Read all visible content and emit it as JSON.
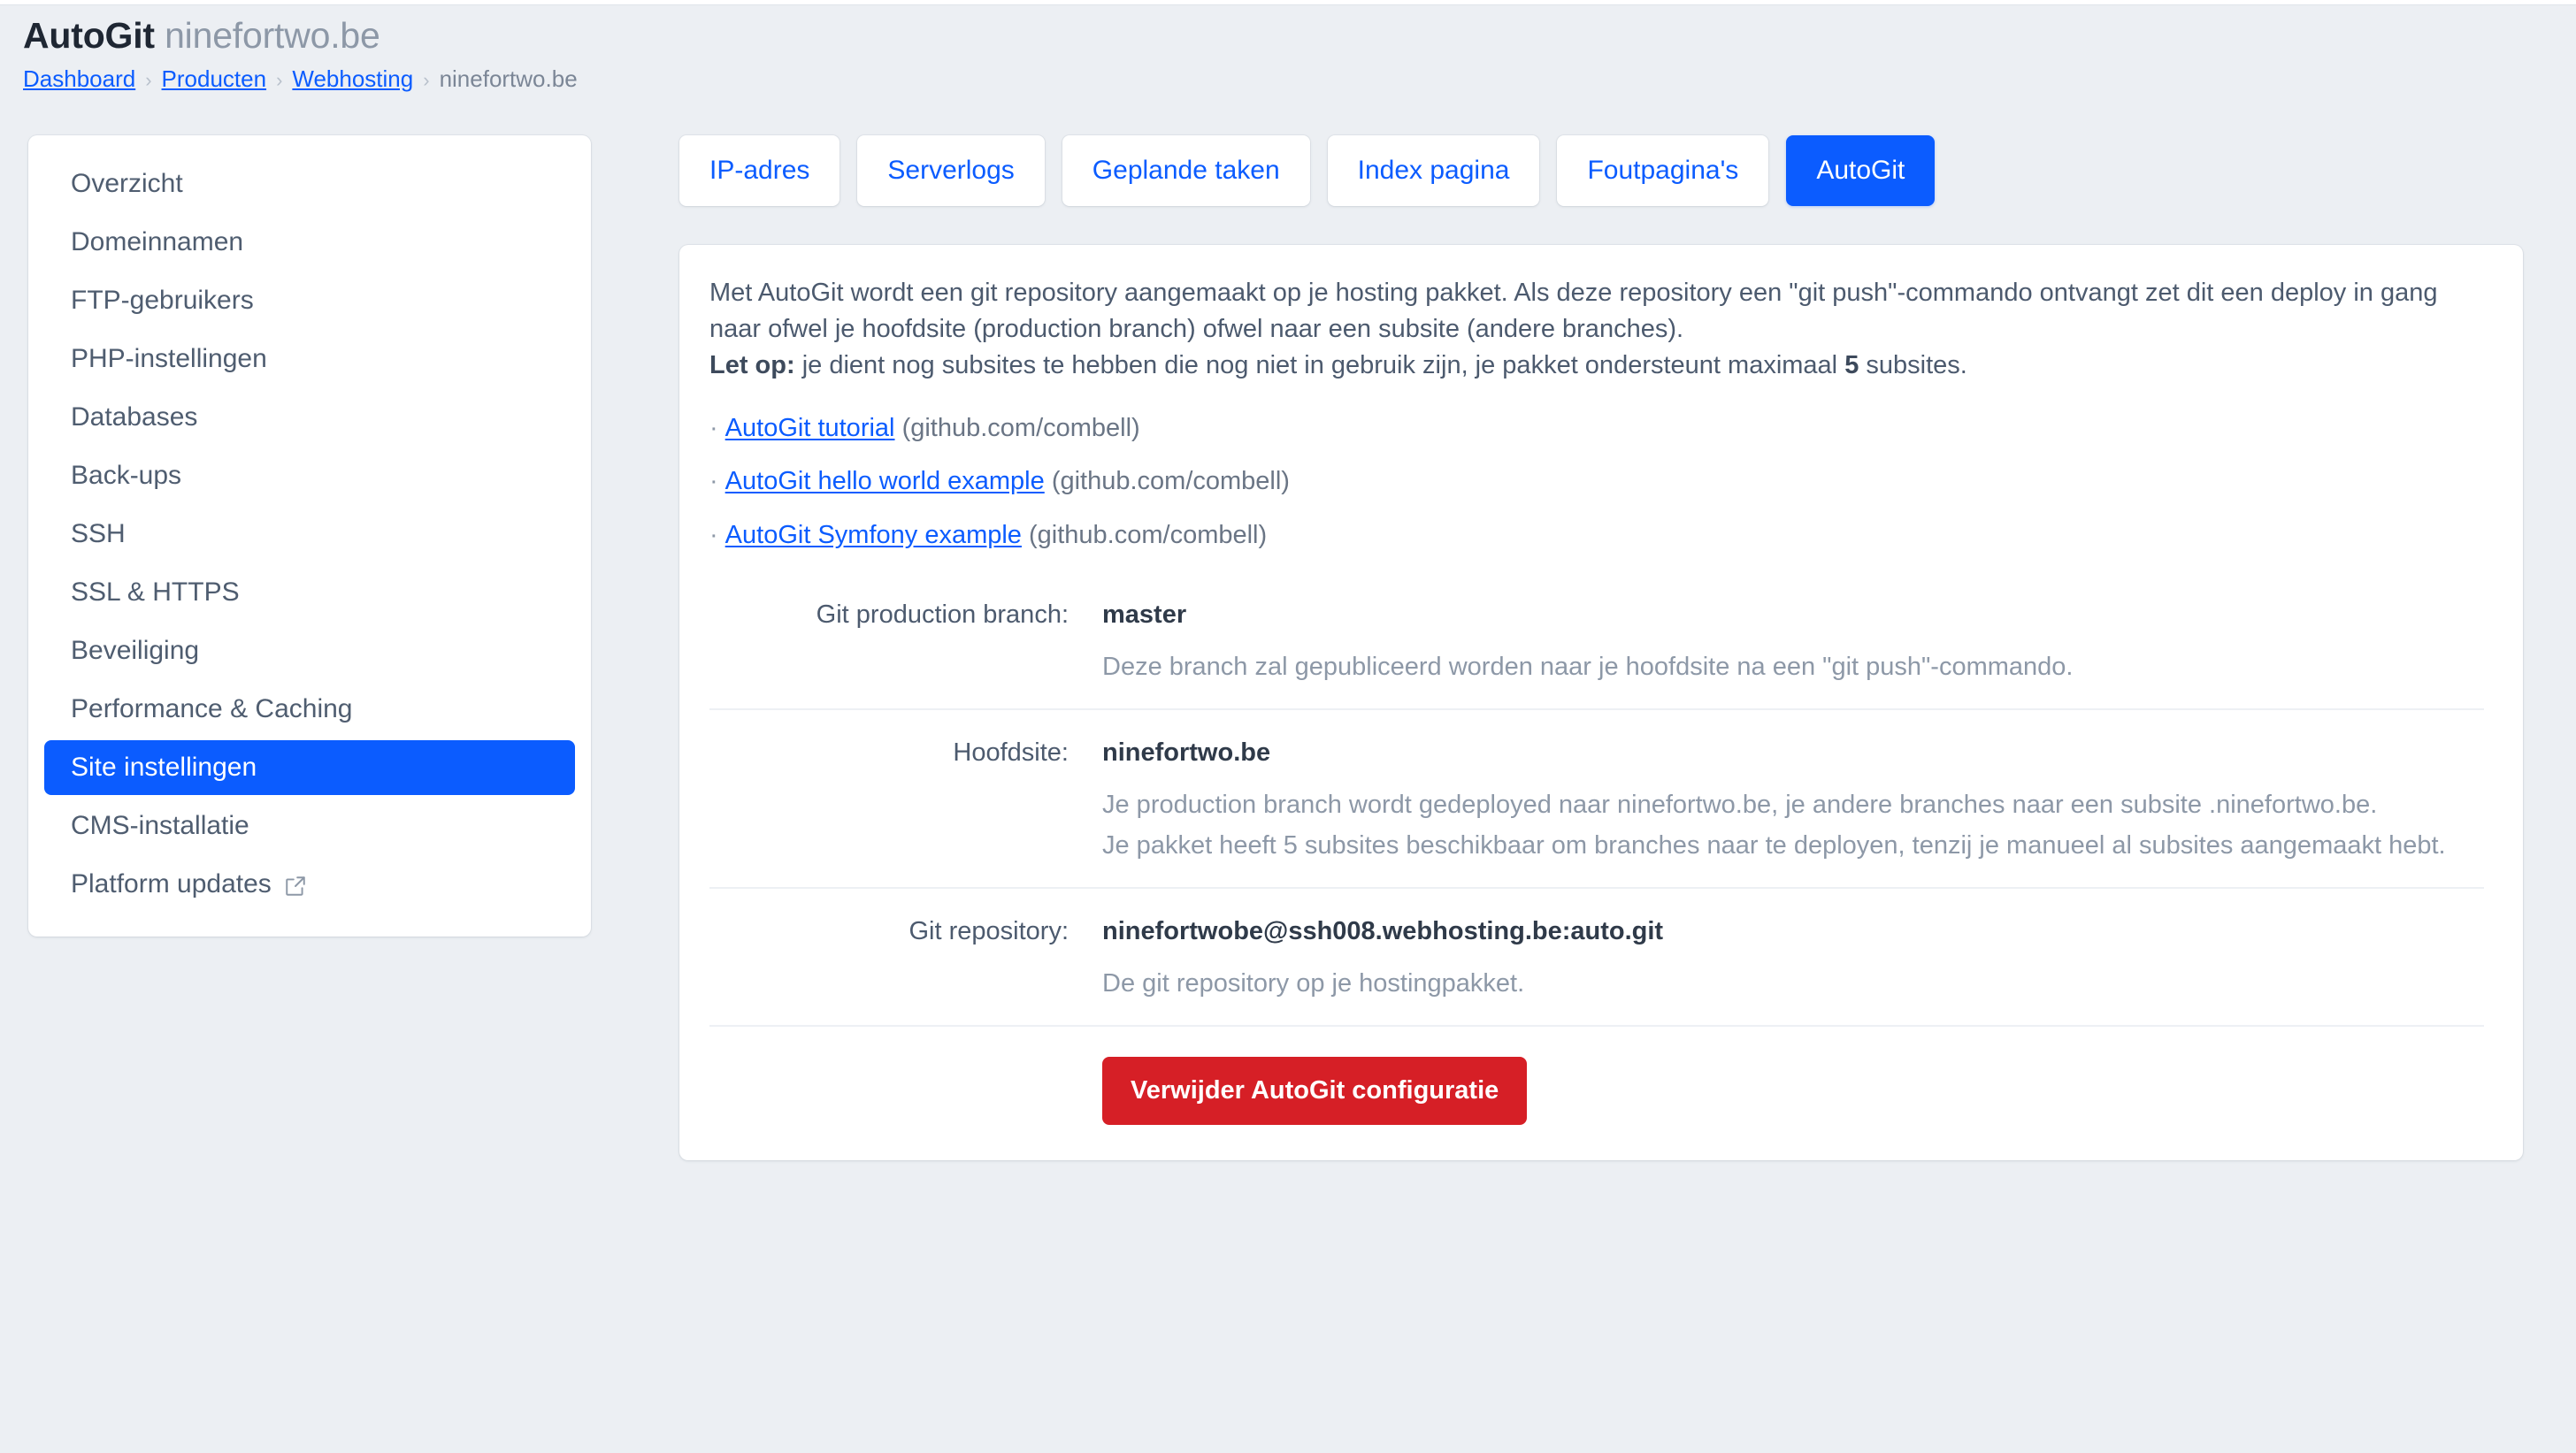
{
  "header": {
    "title_strong": "AutoGit",
    "title_rest": " ninefortwo.be",
    "breadcrumb": [
      {
        "label": "Dashboard",
        "link": true
      },
      {
        "label": "Producten",
        "link": true
      },
      {
        "label": "Webhosting",
        "link": true
      },
      {
        "label": "ninefortwo.be",
        "link": false
      }
    ],
    "separator": "›"
  },
  "sidebar": {
    "items": [
      {
        "label": "Overzicht",
        "active": false,
        "external": false
      },
      {
        "label": "Domeinnamen",
        "active": false,
        "external": false
      },
      {
        "label": "FTP-gebruikers",
        "active": false,
        "external": false
      },
      {
        "label": "PHP-instellingen",
        "active": false,
        "external": false
      },
      {
        "label": "Databases",
        "active": false,
        "external": false
      },
      {
        "label": "Back-ups",
        "active": false,
        "external": false
      },
      {
        "label": "SSH",
        "active": false,
        "external": false
      },
      {
        "label": "SSL & HTTPS",
        "active": false,
        "external": false
      },
      {
        "label": "Beveiliging",
        "active": false,
        "external": false
      },
      {
        "label": "Performance & Caching",
        "active": false,
        "external": false
      },
      {
        "label": "Site instellingen",
        "active": true,
        "external": false
      },
      {
        "label": "CMS-installatie",
        "active": false,
        "external": false
      },
      {
        "label": "Platform updates",
        "active": false,
        "external": true
      }
    ]
  },
  "tabs": [
    {
      "label": "IP-adres",
      "active": false
    },
    {
      "label": "Serverlogs",
      "active": false
    },
    {
      "label": "Geplande taken",
      "active": false
    },
    {
      "label": "Index pagina",
      "active": false
    },
    {
      "label": "Foutpagina's",
      "active": false
    },
    {
      "label": "AutoGit",
      "active": true
    }
  ],
  "panel": {
    "intro_line1": "Met AutoGit wordt een git repository aangemaakt op je hosting pakket. Als deze repository een \"git push\"-commando ontvangt zet dit een deploy in gang naar ofwel je hoofdsite (production branch) ofwel naar een subsite (andere branches).",
    "intro_note_label": "Let op:",
    "intro_note_part1": " je dient nog subsites te hebben die nog niet in gebruik zijn, je pakket ondersteunt maximaal ",
    "intro_note_count": "5",
    "intro_note_part2": " subsites.",
    "links": [
      {
        "bullet": "·",
        "text": "AutoGit tutorial",
        "suffix": "(github.com/combell)"
      },
      {
        "bullet": "·",
        "text": "AutoGit hello world example",
        "suffix": "(github.com/combell)"
      },
      {
        "bullet": "·",
        "text": "AutoGit Symfony example",
        "suffix": "(github.com/combell)"
      }
    ],
    "rows": [
      {
        "label": "Git production branch:",
        "value": "master",
        "help_lines": [
          "Deze branch zal gepubliceerd worden naar je hoofdsite na een \"git push\"-commando."
        ]
      },
      {
        "label": "Hoofdsite:",
        "value": "ninefortwo.be",
        "help_lines": [
          "Je production branch wordt gedeployed naar ninefortwo.be, je andere branches naar een subsite .ninefortwo.be.",
          "Je pakket heeft 5 subsites beschikbaar om branches naar te deployen, tenzij je manueel al subsites aangemaakt hebt."
        ]
      },
      {
        "label": "Git repository:",
        "value": "ninefortwobe@ssh008.webhosting.be:auto.git",
        "help_lines": [
          "De git repository op je hostingpakket."
        ]
      }
    ],
    "delete_button": "Verwijder AutoGit configuratie"
  },
  "colors": {
    "accent_blue": "#0b5cff",
    "danger_red": "#d61f26",
    "page_bg": "#eceff3",
    "text": "#4c5a6e",
    "muted": "#8d98a7"
  }
}
